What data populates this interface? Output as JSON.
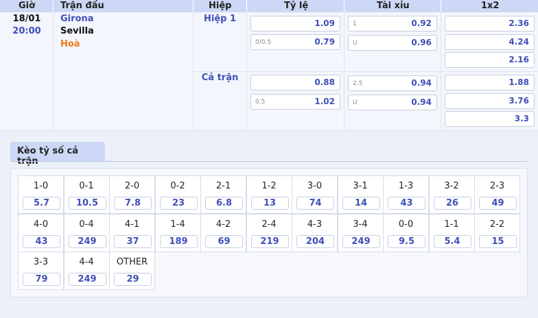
{
  "header": {
    "time": "Giờ",
    "match": "Trận đấu",
    "period": "Hiệp",
    "handicap": "Tỷ lệ",
    "overunder": "Tài xỉu",
    "x12": "1x2"
  },
  "match": {
    "date": "18/01",
    "time": "20:00",
    "home": "Girona",
    "away": "Sevilla",
    "draw": "Hoà"
  },
  "periods": [
    {
      "label": "Hiệp 1",
      "handicap": [
        {
          "line": "",
          "value": "1.09"
        },
        {
          "line": "0/0.5",
          "value": "0.79"
        }
      ],
      "overunder": [
        {
          "line": "1",
          "value": "0.92"
        },
        {
          "line": "U",
          "value": "0.96"
        }
      ],
      "x12": [
        "2.36",
        "4.24",
        "2.16"
      ]
    },
    {
      "label": "Cả trận",
      "handicap": [
        {
          "line": "",
          "value": "0.88"
        },
        {
          "line": "0.5",
          "value": "1.02"
        }
      ],
      "overunder": [
        {
          "line": "2.5",
          "value": "0.94"
        },
        {
          "line": "U",
          "value": "0.94"
        }
      ],
      "x12": [
        "1.88",
        "3.76",
        "3.3"
      ]
    }
  ],
  "correct_score": {
    "title": "Kèo tỷ số cả trận",
    "items": [
      {
        "score": "1-0",
        "odds": "5.7"
      },
      {
        "score": "0-1",
        "odds": "10.5"
      },
      {
        "score": "2-0",
        "odds": "7.8"
      },
      {
        "score": "0-2",
        "odds": "23"
      },
      {
        "score": "2-1",
        "odds": "6.8"
      },
      {
        "score": "1-2",
        "odds": "13"
      },
      {
        "score": "3-0",
        "odds": "74"
      },
      {
        "score": "3-1",
        "odds": "14"
      },
      {
        "score": "1-3",
        "odds": "43"
      },
      {
        "score": "3-2",
        "odds": "26"
      },
      {
        "score": "2-3",
        "odds": "49"
      },
      {
        "score": "4-0",
        "odds": "43"
      },
      {
        "score": "0-4",
        "odds": "249"
      },
      {
        "score": "4-1",
        "odds": "37"
      },
      {
        "score": "1-4",
        "odds": "189"
      },
      {
        "score": "4-2",
        "odds": "69"
      },
      {
        "score": "2-4",
        "odds": "219"
      },
      {
        "score": "4-3",
        "odds": "204"
      },
      {
        "score": "3-4",
        "odds": "249"
      },
      {
        "score": "0-0",
        "odds": "9.5"
      },
      {
        "score": "1-1",
        "odds": "5.4"
      },
      {
        "score": "2-2",
        "odds": "15"
      },
      {
        "score": "3-3",
        "odds": "79"
      },
      {
        "score": "4-4",
        "odds": "249"
      },
      {
        "score": "OTHER",
        "odds": "29"
      }
    ]
  }
}
